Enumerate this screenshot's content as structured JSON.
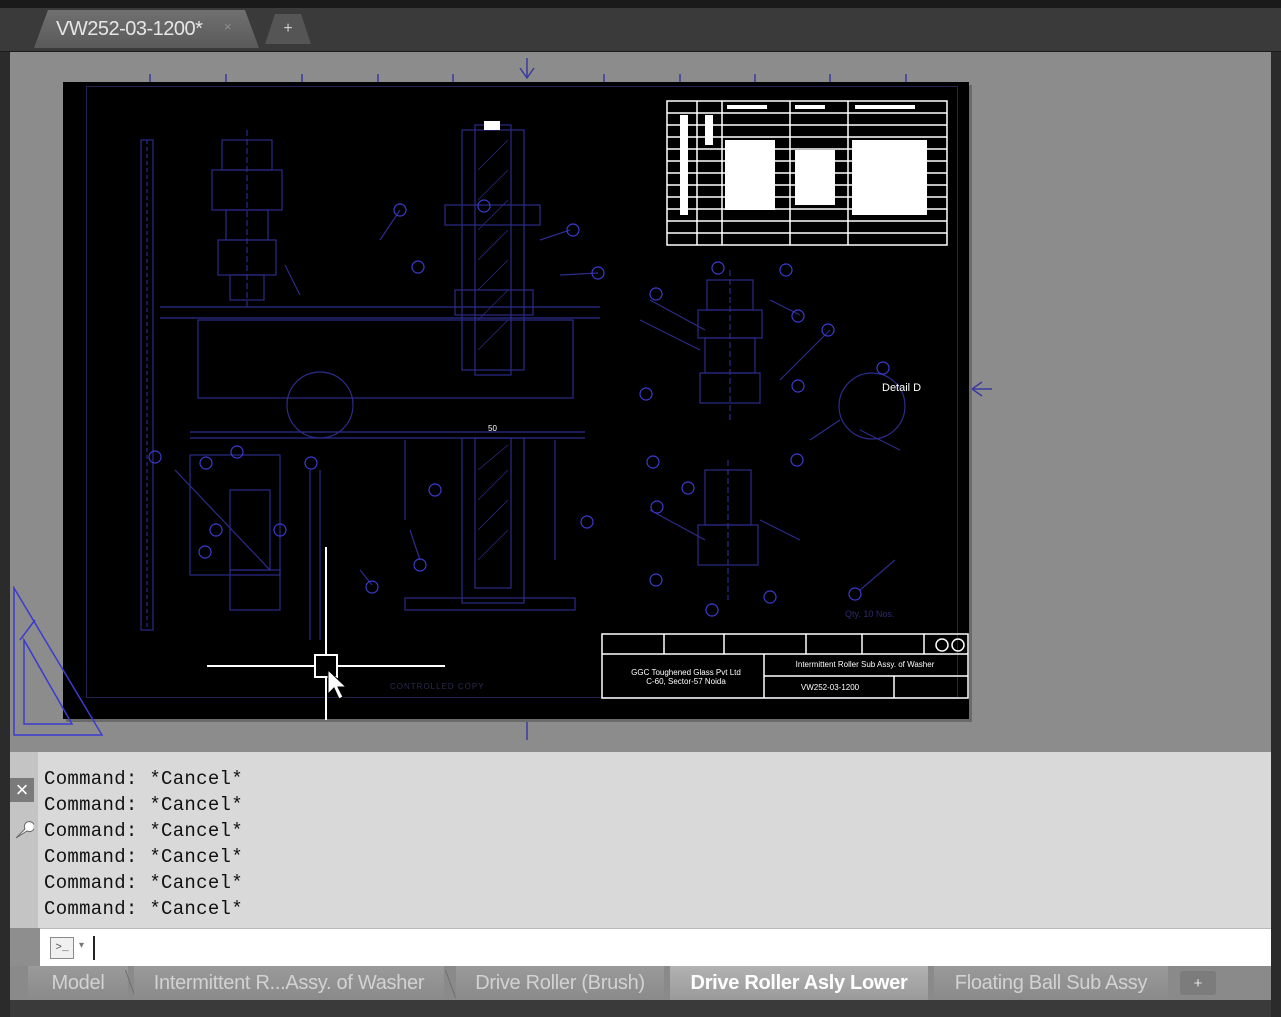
{
  "document_tabs": [
    {
      "label": "VW252-03-1200*"
    }
  ],
  "new_tab_symbol": "+",
  "close_symbol": "×",
  "drawing": {
    "title_block": {
      "company_line1": "GGC Toughened Glass Pvt Ltd",
      "company_line2": "C-60, Sector-57 Noida",
      "drawing_title": "Intermittent Roller Sub Assy. of Washer",
      "drawing_number": "VW252-03-1200"
    },
    "detail_label": "Detail D",
    "qty_label": "Qty. 10 Nos.",
    "dim_label": "50",
    "controlled_label": "CONTROLLED COPY"
  },
  "command_history": [
    "Command: *Cancel*",
    "Command: *Cancel*",
    "Command: *Cancel*",
    "Command: *Cancel*",
    "Command: *Cancel*",
    "Command: *Cancel*"
  ],
  "command_input": {
    "prompt_icon": ">_",
    "dropdown": "▾",
    "value": ""
  },
  "layout_tabs": [
    {
      "label": "Model",
      "active": false
    },
    {
      "label": "Intermittent R...Assy. of Washer",
      "active": false
    },
    {
      "label": "Drive Roller (Brush)",
      "active": false
    },
    {
      "label": "Drive Roller Asly Lower",
      "active": true
    },
    {
      "label": "Floating Ball Sub Assy",
      "active": false
    }
  ],
  "add_layout_symbol": "+",
  "colors": {
    "line": "#2c2c8a",
    "balloon": "#3b3bd0",
    "sheet": "#000000",
    "workspace": "#8c8c8c"
  }
}
